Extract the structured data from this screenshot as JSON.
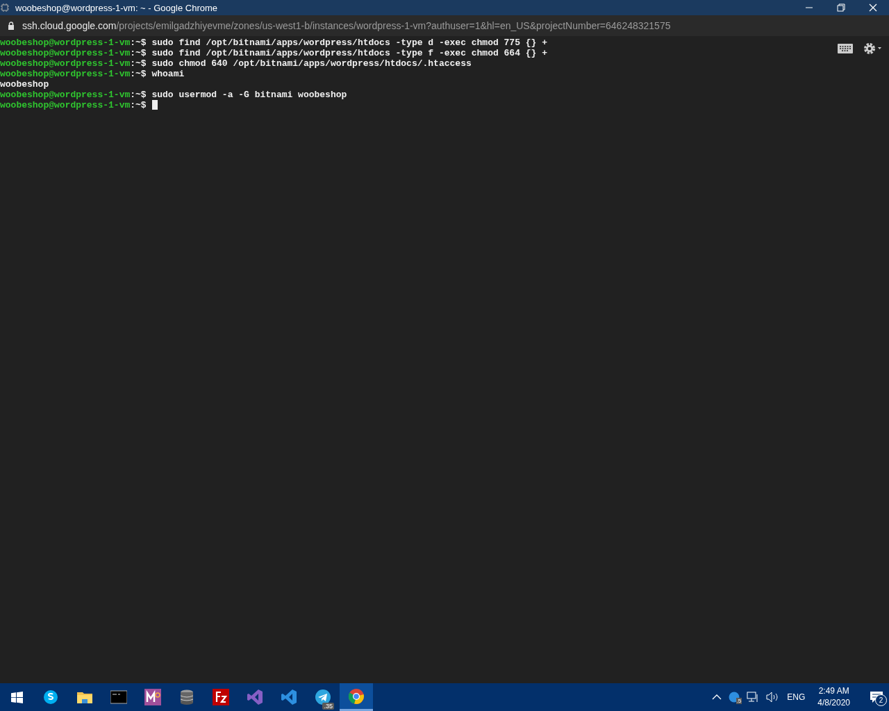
{
  "window": {
    "title": "woobeshop@wordpress-1-vm: ~ - Google Chrome"
  },
  "address_bar": {
    "host": "ssh.cloud.google.com",
    "path": "/projects/emilgadzhiyevme/zones/us-west1-b/instances/wordpress-1-vm?authuser=1&hl=en_US&projectNumber=646248321575"
  },
  "terminal": {
    "lines": [
      {
        "kind": "prompt",
        "user": "woobeshop@wordpress-1-vm",
        "sep": ":~$",
        "command": "sudo find /opt/bitnami/apps/wordpress/htdocs -type d -exec chmod 775 {} +"
      },
      {
        "kind": "prompt",
        "user": "woobeshop@wordpress-1-vm",
        "sep": ":~$",
        "command": "sudo find /opt/bitnami/apps/wordpress/htdocs -type f -exec chmod 664 {} +"
      },
      {
        "kind": "prompt",
        "user": "woobeshop@wordpress-1-vm",
        "sep": ":~$",
        "command": "sudo chmod 640 /opt/bitnami/apps/wordpress/htdocs/.htaccess"
      },
      {
        "kind": "prompt",
        "user": "woobeshop@wordpress-1-vm",
        "sep": ":~$",
        "command": "whoami"
      },
      {
        "kind": "output",
        "text": "woobeshop"
      },
      {
        "kind": "prompt",
        "user": "woobeshop@wordpress-1-vm",
        "sep": ":~$",
        "command": "sudo usermod -a -G bitnami woobeshop"
      },
      {
        "kind": "prompt",
        "user": "woobeshop@wordpress-1-vm",
        "sep": ":~$",
        "cursor": true
      }
    ]
  },
  "taskbar": {
    "apps": [
      {
        "kind": "chat",
        "selected": false
      },
      {
        "kind": "folder",
        "selected": false
      },
      {
        "kind": "console",
        "selected": false
      },
      {
        "kind": "letter",
        "selected": false
      },
      {
        "kind": "database",
        "selected": false
      },
      {
        "kind": "transfer",
        "selected": false
      },
      {
        "kind": "ide",
        "selected": false
      },
      {
        "kind": "editor",
        "selected": false
      },
      {
        "kind": "plane",
        "selected": false,
        "badge": ".35"
      },
      {
        "kind": "browser",
        "selected": true
      }
    ],
    "tray": {
      "badge": ".5",
      "language": "ENG",
      "time": "2:49 AM",
      "date": "4/8/2020",
      "notifications": "2"
    }
  }
}
